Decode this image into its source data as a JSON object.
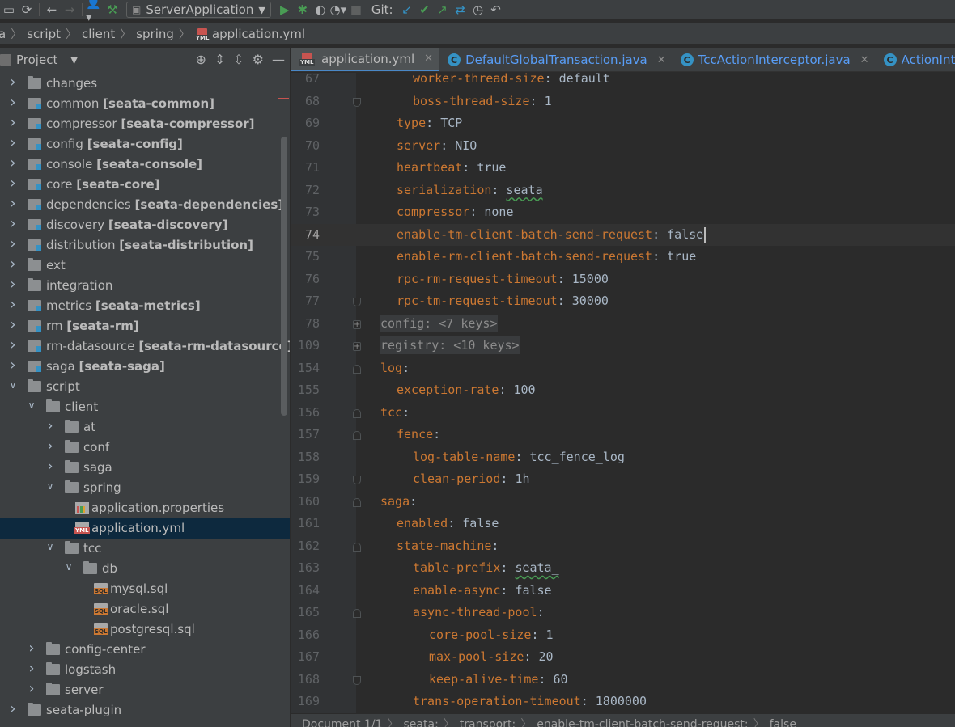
{
  "toolbar": {
    "run_config": "ServerApplication",
    "git_label": "Git:"
  },
  "breadcrumb": [
    "a",
    "script",
    "client",
    "spring",
    "application.yml"
  ],
  "project": {
    "title": "Project",
    "tree": [
      {
        "name": "changes",
        "tag": "",
        "depth": 0,
        "kind": "folder",
        "arrow": "right"
      },
      {
        "name": "common",
        "tag": "[seata-common]",
        "depth": 0,
        "kind": "module",
        "arrow": "right"
      },
      {
        "name": "compressor",
        "tag": "[seata-compressor]",
        "depth": 0,
        "kind": "module",
        "arrow": "right"
      },
      {
        "name": "config",
        "tag": "[seata-config]",
        "depth": 0,
        "kind": "module",
        "arrow": "right"
      },
      {
        "name": "console",
        "tag": "[seata-console]",
        "depth": 0,
        "kind": "module",
        "arrow": "right"
      },
      {
        "name": "core",
        "tag": "[seata-core]",
        "depth": 0,
        "kind": "module",
        "arrow": "right"
      },
      {
        "name": "dependencies",
        "tag": "[seata-dependencies]",
        "depth": 0,
        "kind": "module",
        "arrow": "right"
      },
      {
        "name": "discovery",
        "tag": "[seata-discovery]",
        "depth": 0,
        "kind": "module",
        "arrow": "right"
      },
      {
        "name": "distribution",
        "tag": "[seata-distribution]",
        "depth": 0,
        "kind": "module",
        "arrow": "right"
      },
      {
        "name": "ext",
        "tag": "",
        "depth": 0,
        "kind": "folder",
        "arrow": "right"
      },
      {
        "name": "integration",
        "tag": "",
        "depth": 0,
        "kind": "folder",
        "arrow": "right"
      },
      {
        "name": "metrics",
        "tag": "[seata-metrics]",
        "depth": 0,
        "kind": "module",
        "arrow": "right"
      },
      {
        "name": "rm",
        "tag": "[seata-rm]",
        "depth": 0,
        "kind": "module",
        "arrow": "right"
      },
      {
        "name": "rm-datasource",
        "tag": "[seata-rm-datasource]",
        "depth": 0,
        "kind": "module",
        "arrow": "right"
      },
      {
        "name": "saga",
        "tag": "[seata-saga]",
        "depth": 0,
        "kind": "module",
        "arrow": "right"
      },
      {
        "name": "script",
        "tag": "",
        "depth": 0,
        "kind": "folder",
        "arrow": "down"
      },
      {
        "name": "client",
        "tag": "",
        "depth": 1,
        "kind": "folder",
        "arrow": "down"
      },
      {
        "name": "at",
        "tag": "",
        "depth": 2,
        "kind": "folder",
        "arrow": "right"
      },
      {
        "name": "conf",
        "tag": "",
        "depth": 2,
        "kind": "folder",
        "arrow": "right"
      },
      {
        "name": "saga",
        "tag": "",
        "depth": 2,
        "kind": "folder",
        "arrow": "right"
      },
      {
        "name": "spring",
        "tag": "",
        "depth": 2,
        "kind": "folder",
        "arrow": "down"
      },
      {
        "name": "application.properties",
        "tag": "",
        "depth": 3,
        "kind": "propfile",
        "arrow": ""
      },
      {
        "name": "application.yml",
        "tag": "",
        "depth": 3,
        "kind": "ymlfile",
        "arrow": "",
        "selected": true
      },
      {
        "name": "tcc",
        "tag": "",
        "depth": 2,
        "kind": "folder",
        "arrow": "down"
      },
      {
        "name": "db",
        "tag": "",
        "depth": 3,
        "kind": "folder",
        "arrow": "down"
      },
      {
        "name": "mysql.sql",
        "tag": "",
        "depth": 4,
        "kind": "sqlfile",
        "arrow": ""
      },
      {
        "name": "oracle.sql",
        "tag": "",
        "depth": 4,
        "kind": "sqlfile",
        "arrow": ""
      },
      {
        "name": "postgresql.sql",
        "tag": "",
        "depth": 4,
        "kind": "sqlfile",
        "arrow": ""
      },
      {
        "name": "config-center",
        "tag": "",
        "depth": 1,
        "kind": "folder",
        "arrow": "right"
      },
      {
        "name": "logstash",
        "tag": "",
        "depth": 1,
        "kind": "folder",
        "arrow": "right"
      },
      {
        "name": "server",
        "tag": "",
        "depth": 1,
        "kind": "folder",
        "arrow": "right"
      },
      {
        "name": "seata-plugin",
        "tag": "",
        "depth": 0,
        "kind": "folder",
        "arrow": "right"
      }
    ]
  },
  "tabs": [
    {
      "label": "application.yml",
      "icon": "yml",
      "active": true
    },
    {
      "label": "DefaultGlobalTransaction.java",
      "icon": "java",
      "active": false
    },
    {
      "label": "TccActionInterceptor.java",
      "icon": "java",
      "active": false
    },
    {
      "label": "ActionInter",
      "icon": "java",
      "active": false
    }
  ],
  "editor": {
    "lines": [
      {
        "num": "67",
        "indent": 2,
        "key": "worker-thread-size",
        "val": "default",
        "fold": ""
      },
      {
        "num": "68",
        "indent": 2,
        "key": "boss-thread-size",
        "val": "1",
        "fold": "end"
      },
      {
        "num": "69",
        "indent": 1,
        "key": "type",
        "val": "TCP",
        "fold": ""
      },
      {
        "num": "70",
        "indent": 1,
        "key": "server",
        "val": "NIO",
        "fold": ""
      },
      {
        "num": "71",
        "indent": 1,
        "key": "heartbeat",
        "val": "true",
        "fold": ""
      },
      {
        "num": "72",
        "indent": 1,
        "key": "serialization",
        "val": "seata",
        "fold": "",
        "wavy": true
      },
      {
        "num": "73",
        "indent": 1,
        "key": "compressor",
        "val": "none",
        "fold": ""
      },
      {
        "num": "74",
        "indent": 1,
        "key": "enable-tm-client-batch-send-request",
        "val": "false",
        "fold": "",
        "current": true
      },
      {
        "num": "75",
        "indent": 1,
        "key": "enable-rm-client-batch-send-request",
        "val": "true",
        "fold": ""
      },
      {
        "num": "76",
        "indent": 1,
        "key": "rpc-rm-request-timeout",
        "val": "15000",
        "fold": ""
      },
      {
        "num": "77",
        "indent": 1,
        "key": "rpc-tm-request-timeout",
        "val": "30000",
        "fold": "end"
      },
      {
        "num": "78",
        "indent": 0,
        "folded": "config: <7 keys>",
        "fold": "plus"
      },
      {
        "num": "109",
        "indent": 0,
        "folded": "registry: <10 keys>",
        "fold": "plus"
      },
      {
        "num": "154",
        "indent": 0,
        "key": "log",
        "val": "",
        "fold": "start"
      },
      {
        "num": "155",
        "indent": 1,
        "key": "exception-rate",
        "val": "100",
        "fold": ""
      },
      {
        "num": "156",
        "indent": 0,
        "key": "tcc",
        "val": "",
        "fold": "start"
      },
      {
        "num": "157",
        "indent": 1,
        "key": "fence",
        "val": "",
        "fold": "start"
      },
      {
        "num": "158",
        "indent": 2,
        "key": "log-table-name",
        "val": "tcc_fence_log",
        "fold": ""
      },
      {
        "num": "159",
        "indent": 2,
        "key": "clean-period",
        "val": "1h",
        "fold": "end"
      },
      {
        "num": "160",
        "indent": 0,
        "key": "saga",
        "val": "",
        "fold": "start"
      },
      {
        "num": "161",
        "indent": 1,
        "key": "enabled",
        "val": "false",
        "fold": ""
      },
      {
        "num": "162",
        "indent": 1,
        "key": "state-machine",
        "val": "",
        "fold": "start"
      },
      {
        "num": "163",
        "indent": 2,
        "key": "table-prefix",
        "val": "seata_",
        "fold": "",
        "wavy": true
      },
      {
        "num": "164",
        "indent": 2,
        "key": "enable-async",
        "val": "false",
        "fold": ""
      },
      {
        "num": "165",
        "indent": 2,
        "key": "async-thread-pool",
        "val": "",
        "fold": "start"
      },
      {
        "num": "166",
        "indent": 3,
        "key": "core-pool-size",
        "val": "1",
        "fold": ""
      },
      {
        "num": "167",
        "indent": 3,
        "key": "max-pool-size",
        "val": "20",
        "fold": ""
      },
      {
        "num": "168",
        "indent": 3,
        "key": "keep-alive-time",
        "val": "60",
        "fold": "end"
      },
      {
        "num": "169",
        "indent": 2,
        "key": "trans-operation-timeout",
        "val": "1800000",
        "fold": ""
      }
    ]
  },
  "bottom_breadcrumb": [
    "Document 1/1",
    "seata:",
    "transport:",
    "enable-tm-client-batch-send-request:",
    "false"
  ]
}
